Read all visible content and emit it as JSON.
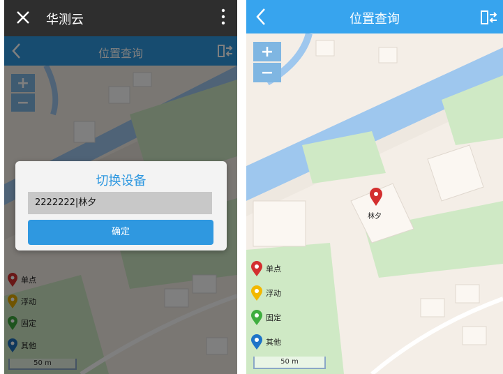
{
  "left": {
    "wechat": {
      "title": "华测云"
    },
    "app": {
      "title": "位置查询"
    },
    "dialog": {
      "title": "切换设备",
      "input_value": "2222222|林夕",
      "confirm_label": "确定"
    },
    "legend": [
      {
        "label": "单点",
        "color": "#d32f2f"
      },
      {
        "label": "浮动",
        "color": "#e0a800"
      },
      {
        "label": "固定",
        "color": "#3ca63c"
      },
      {
        "label": "其他",
        "color": "#1e6fb8"
      }
    ],
    "scale": "50 m"
  },
  "right": {
    "app": {
      "title": "位置查询"
    },
    "marker": {
      "label": "林夕",
      "color": "#d32f2f"
    },
    "legend": [
      {
        "label": "单点",
        "color": "#d32f2f"
      },
      {
        "label": "浮动",
        "color": "#f2b800"
      },
      {
        "label": "固定",
        "color": "#3fae3f"
      },
      {
        "label": "其他",
        "color": "#1e74c8"
      }
    ],
    "scale": "50 m"
  },
  "zoom": {
    "in": "+",
    "out": "−"
  },
  "colors": {
    "accent": "#2f98e0",
    "river": "#9ec7ee",
    "park": "#cfe9c5",
    "map": "#f4eee7"
  }
}
